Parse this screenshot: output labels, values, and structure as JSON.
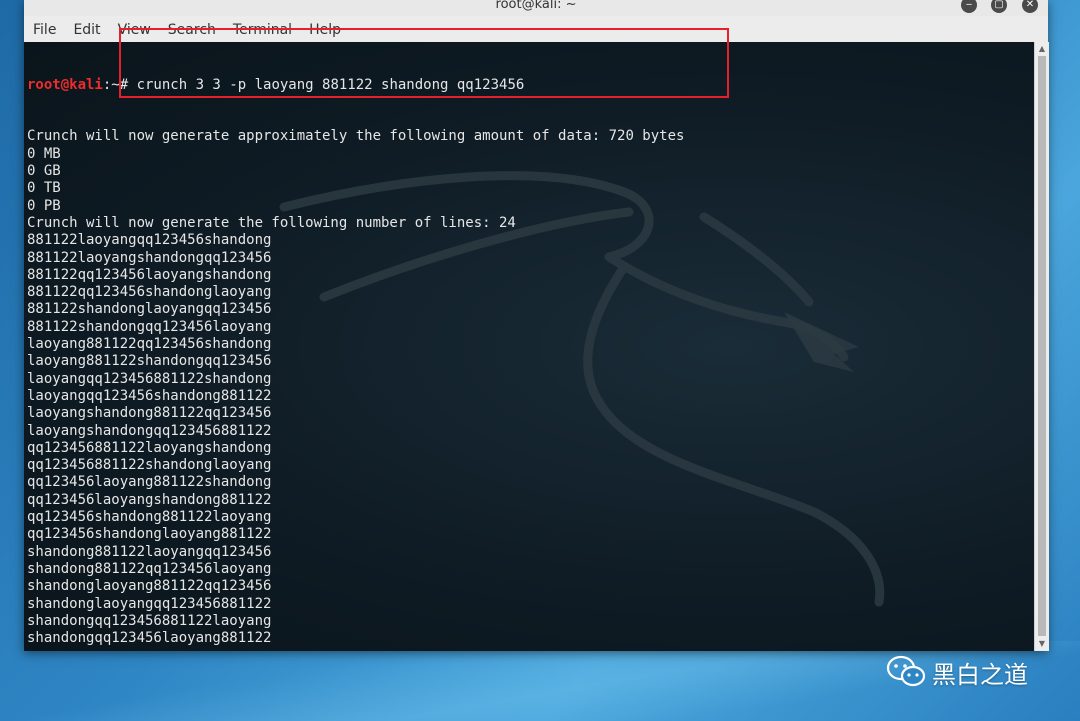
{
  "window": {
    "title": "root@kali: ~",
    "buttons": {
      "minimize": "‒",
      "maximize": "▢",
      "close": "✕"
    }
  },
  "menu": [
    "File",
    "Edit",
    "View",
    "Search",
    "Terminal",
    "Help"
  ],
  "terminal": {
    "prompt_user": "root@kali",
    "prompt_path": ":~# ",
    "command": "crunch 3 3 -p laoyang 881122 shandong qq123456",
    "output": [
      "Crunch will now generate approximately the following amount of data: 720 bytes",
      "0 MB",
      "0 GB",
      "0 TB",
      "0 PB",
      "Crunch will now generate the following number of lines: 24",
      "881122laoyangqq123456shandong",
      "881122laoyangshandongqq123456",
      "881122qq123456laoyangshandong",
      "881122qq123456shandonglaoyang",
      "881122shandonglaoyangqq123456",
      "881122shandongqq123456laoyang",
      "laoyang881122qq123456shandong",
      "laoyang881122shandongqq123456",
      "laoyangqq123456881122shandong",
      "laoyangqq123456shandong881122",
      "laoyangshandong881122qq123456",
      "laoyangshandongqq123456881122",
      "qq123456881122laoyangshandong",
      "qq123456881122shandonglaoyang",
      "qq123456laoyang881122shandong",
      "qq123456laoyangshandong881122",
      "qq123456shandong881122laoyang",
      "qq123456shandonglaoyang881122",
      "shandong881122laoyangqq123456",
      "shandong881122qq123456laoyang",
      "shandonglaoyang881122qq123456",
      "shandonglaoyangqq123456881122",
      "shandongqq123456881122laoyang",
      "shandongqq123456laoyang881122"
    ]
  },
  "annotation": {
    "color": "#e5202b"
  },
  "watermark": {
    "text": "黑白之道",
    "icon": "wechat-icon"
  }
}
